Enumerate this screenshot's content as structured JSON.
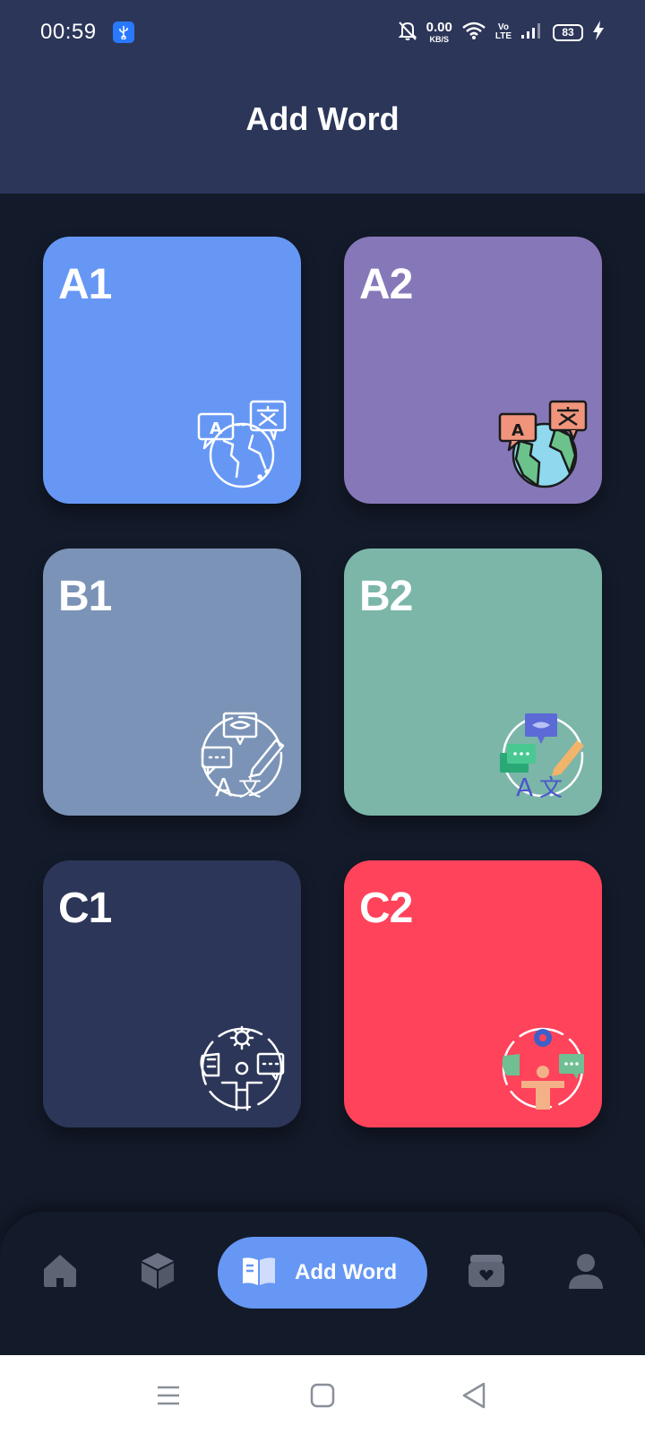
{
  "status_bar": {
    "time": "00:59",
    "net_speed_value": "0.00",
    "net_speed_unit": "KB/S",
    "volte_top": "Vo",
    "volte_bottom": "LTE",
    "battery": "83",
    "icons": [
      "usb-icon",
      "mute-bell-icon",
      "wifi-icon",
      "signal-icon",
      "battery-icon",
      "charging-icon"
    ]
  },
  "header": {
    "title": "Add Word"
  },
  "levels": [
    {
      "id": "a1",
      "label": "A1",
      "color": "#6697f4",
      "icon": "translate-globe-icon"
    },
    {
      "id": "a2",
      "label": "A2",
      "color": "#8678b8",
      "icon": "translate-globe-icon"
    },
    {
      "id": "b1",
      "label": "B1",
      "color": "#7b93b6",
      "icon": "language-skills-icon"
    },
    {
      "id": "b2",
      "label": "B2",
      "color": "#7bb6a9",
      "icon": "language-skills-icon"
    },
    {
      "id": "c1",
      "label": "C1",
      "color": "#2c3659",
      "icon": "communication-mind-icon"
    },
    {
      "id": "c2",
      "label": "C2",
      "color": "#fe435b",
      "icon": "communication-mind-icon"
    }
  ],
  "bottom_nav": {
    "active_label": "Add Word",
    "active_color": "#6697f4",
    "items": [
      "home-icon",
      "box-icon",
      "add-word-book-icon",
      "saved-folder-icon",
      "profile-icon"
    ]
  },
  "system_nav": [
    "menu-icon",
    "home-square-icon",
    "back-triangle-icon"
  ],
  "colors": {
    "background": "#131a29",
    "header": "#2c3659",
    "inactive_icon": "#5d6474"
  }
}
